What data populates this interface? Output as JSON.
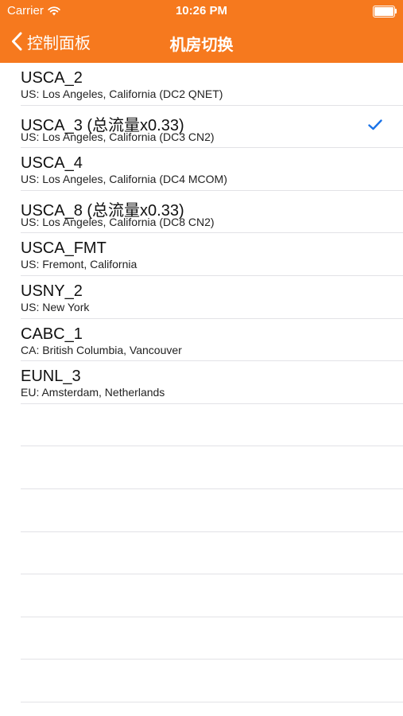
{
  "status_bar": {
    "carrier": "Carrier",
    "time": "10:26 PM"
  },
  "nav": {
    "back_label": "控制面板",
    "title": "机房切换",
    "bar_color": "#f6791e"
  },
  "accent_color": "#1a73e8",
  "servers": [
    {
      "title": "USCA_2",
      "subtitle": "US: Los Angeles, California (DC2 QNET)",
      "selected": false
    },
    {
      "title": "USCA_3 (总流量x0.33)",
      "subtitle": "US: Los Angeles, California (DC3 CN2)",
      "selected": true
    },
    {
      "title": "USCA_4",
      "subtitle": "US: Los Angeles, California (DC4 MCOM)",
      "selected": false
    },
    {
      "title": "USCA_8 (总流量x0.33)",
      "subtitle": "US: Los Angeles, California (DC8 CN2)",
      "selected": false
    },
    {
      "title": "USCA_FMT",
      "subtitle": "US: Fremont, California",
      "selected": false
    },
    {
      "title": "USNY_2",
      "subtitle": "US: New York",
      "selected": false
    },
    {
      "title": "CABC_1",
      "subtitle": "CA: British Columbia, Vancouver",
      "selected": false
    },
    {
      "title": "EUNL_3",
      "subtitle": "EU: Amsterdam, Netherlands",
      "selected": false
    }
  ]
}
